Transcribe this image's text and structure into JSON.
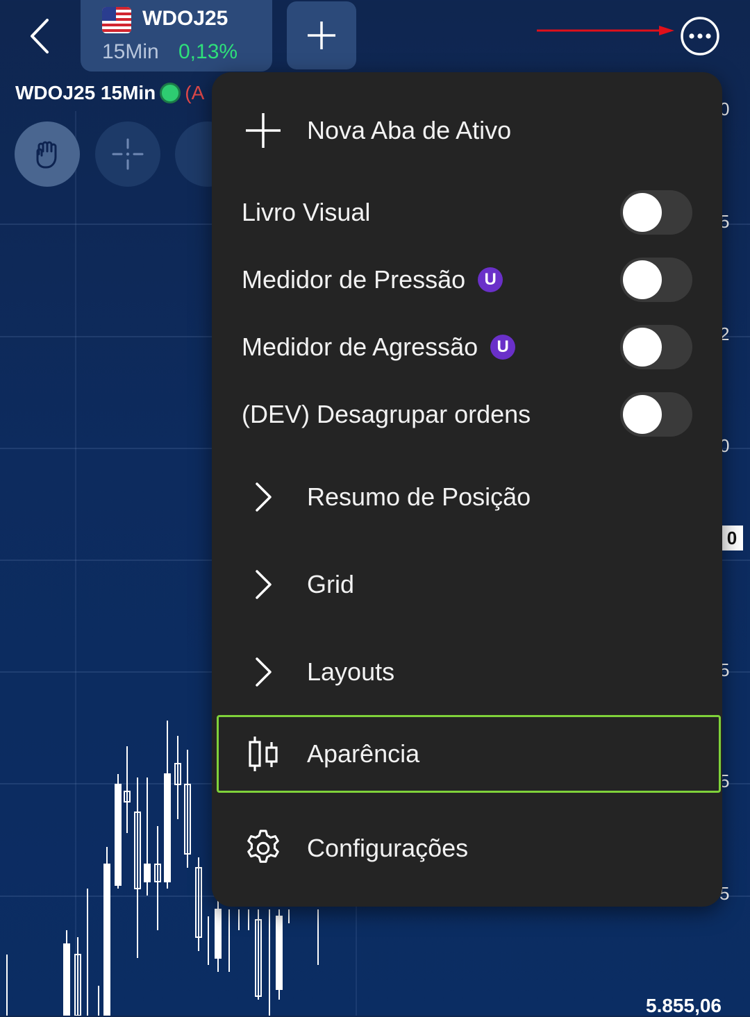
{
  "header": {
    "asset_symbol": "WDOJ25",
    "asset_interval": "15Min",
    "asset_change": "0,13%"
  },
  "chart": {
    "label": "WDOJ25 15Min",
    "label_suffix": "(A",
    "price_tag": "0",
    "axis_fragments": [
      "0",
      "5",
      "2",
      "0",
      "5",
      "5",
      "5"
    ],
    "bottom_price": "5.855,06"
  },
  "menu": {
    "new_tab": "Nova Aba de Ativo",
    "toggles": [
      {
        "label": "Livro Visual",
        "badge": "",
        "on": false
      },
      {
        "label": "Medidor de Pressão",
        "badge": "U",
        "on": false
      },
      {
        "label": "Medidor de Agressão",
        "badge": "U",
        "on": false
      },
      {
        "label": "(DEV) Desagrupar ordens",
        "badge": "",
        "on": false
      }
    ],
    "position_summary": "Resumo de Posição",
    "grid": "Grid",
    "layouts": "Layouts",
    "appearance": "Aparência",
    "settings": "Configurações"
  },
  "colors": {
    "positive": "#2ee07a",
    "badge": "#6a30c9",
    "highlight": "#7fd23a",
    "annotation_arrow": "#e0101a"
  }
}
